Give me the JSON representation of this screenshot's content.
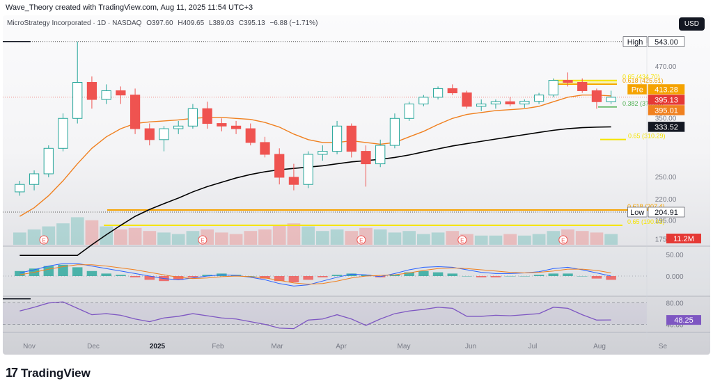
{
  "credit": "Wave_Theory created with TradingView.com, Aug 11, 2025 11:54 UTC+3",
  "symbol": {
    "name": "MicroStrategy Incorporated · 1D · NASDAQ",
    "open": "O397.60",
    "high": "H409.65",
    "low": "L389.03",
    "close": "C395.13",
    "change": "−6.88 (−1.71%)"
  },
  "currency_button": "USD",
  "brand": "TradingView",
  "colors": {
    "up": "#26a69a",
    "down": "#ef5350",
    "ema50": "#f0801f",
    "ema200": "#000000",
    "fib_orange": "#f5a300",
    "fib_yellow": "#f5e400",
    "macd": "#2962ff",
    "rsi": "#7e57c2"
  },
  "chart_data": {
    "type": "candlestick",
    "x_labels": [
      "Nov",
      "Dec",
      "2025",
      "Feb",
      "Mar",
      "Apr",
      "May",
      "Jun",
      "Jul",
      "Aug",
      "Se"
    ],
    "price_axis": {
      "ticks": [
        470.0,
        350.0,
        250.0,
        220.0,
        195.0,
        175.0
      ],
      "tick_labels": [
        "470.00",
        "350.00",
        "250.00",
        "220.00",
        "195.00",
        "175.00"
      ],
      "scale": "log"
    },
    "price_tags": [
      {
        "label": "High",
        "value": "543.00"
      },
      {
        "label": "Pre",
        "value": "413.28"
      },
      {
        "label": "",
        "value": "395.13"
      },
      {
        "label": "",
        "value": "395.01"
      },
      {
        "label": "",
        "value": "333.52"
      },
      {
        "label": "Low",
        "value": "204.91"
      }
    ],
    "fib_levels": [
      {
        "label": "0.65 (434.70)",
        "value": 434.7
      },
      {
        "label": "0.618 (425.61)",
        "value": 425.61
      },
      {
        "label": "0.382 (373.55)",
        "value": 373.55
      },
      {
        "label": "0.65 (310.29)",
        "value": 310.29
      },
      {
        "label": "0.618 (207.4)",
        "value": 207.4
      },
      {
        "label": "0.65 (190.03)",
        "value": 190.03
      }
    ],
    "candles_weekly_approx": [
      {
        "d": "Oct 21",
        "o": 230,
        "h": 245,
        "l": 225,
        "c": 240
      },
      {
        "d": "Oct 28",
        "o": 240,
        "h": 260,
        "l": 232,
        "c": 255
      },
      {
        "d": "Nov 4",
        "o": 255,
        "h": 300,
        "l": 250,
        "c": 295
      },
      {
        "d": "Nov 11",
        "o": 295,
        "h": 360,
        "l": 290,
        "c": 350
      },
      {
        "d": "Nov 18",
        "o": 350,
        "h": 543,
        "l": 340,
        "c": 430
      },
      {
        "d": "Nov 25",
        "o": 430,
        "h": 445,
        "l": 370,
        "c": 390
      },
      {
        "d": "Dec 2",
        "o": 390,
        "h": 425,
        "l": 380,
        "c": 410
      },
      {
        "d": "Dec 9",
        "o": 410,
        "h": 420,
        "l": 380,
        "c": 400
      },
      {
        "d": "Dec 16",
        "o": 400,
        "h": 415,
        "l": 320,
        "c": 330
      },
      {
        "d": "Dec 23",
        "o": 330,
        "h": 340,
        "l": 300,
        "c": 310
      },
      {
        "d": "Dec 30",
        "o": 310,
        "h": 335,
        "l": 290,
        "c": 330
      },
      {
        "d": "Jan 6",
        "o": 330,
        "h": 345,
        "l": 320,
        "c": 335
      },
      {
        "d": "Jan 13",
        "o": 335,
        "h": 380,
        "l": 330,
        "c": 370
      },
      {
        "d": "Jan 20",
        "o": 370,
        "h": 385,
        "l": 330,
        "c": 340
      },
      {
        "d": "Jan 27",
        "o": 340,
        "h": 350,
        "l": 325,
        "c": 335
      },
      {
        "d": "Feb 3",
        "o": 335,
        "h": 345,
        "l": 320,
        "c": 330
      },
      {
        "d": "Feb 10",
        "o": 330,
        "h": 340,
        "l": 300,
        "c": 305
      },
      {
        "d": "Feb 17",
        "o": 305,
        "h": 315,
        "l": 280,
        "c": 285
      },
      {
        "d": "Feb 24",
        "o": 285,
        "h": 295,
        "l": 240,
        "c": 250
      },
      {
        "d": "Mar 3",
        "o": 250,
        "h": 270,
        "l": 232,
        "c": 240
      },
      {
        "d": "Mar 10",
        "o": 240,
        "h": 290,
        "l": 235,
        "c": 285
      },
      {
        "d": "Mar 17",
        "o": 285,
        "h": 300,
        "l": 275,
        "c": 290
      },
      {
        "d": "Mar 24",
        "o": 290,
        "h": 345,
        "l": 285,
        "c": 335
      },
      {
        "d": "Mar 31",
        "o": 335,
        "h": 340,
        "l": 280,
        "c": 290
      },
      {
        "d": "Apr 7",
        "o": 290,
        "h": 300,
        "l": 237,
        "c": 270
      },
      {
        "d": "Apr 14",
        "o": 270,
        "h": 310,
        "l": 265,
        "c": 300
      },
      {
        "d": "Apr 21",
        "o": 300,
        "h": 360,
        "l": 295,
        "c": 350
      },
      {
        "d": "Apr 28",
        "o": 350,
        "h": 385,
        "l": 345,
        "c": 380
      },
      {
        "d": "May 5",
        "o": 380,
        "h": 400,
        "l": 375,
        "c": 395
      },
      {
        "d": "May 12",
        "o": 395,
        "h": 420,
        "l": 390,
        "c": 415
      },
      {
        "d": "May 19",
        "o": 415,
        "h": 425,
        "l": 400,
        "c": 405
      },
      {
        "d": "May 26",
        "o": 405,
        "h": 410,
        "l": 370,
        "c": 375
      },
      {
        "d": "Jun 2",
        "o": 375,
        "h": 390,
        "l": 365,
        "c": 380
      },
      {
        "d": "Jun 9",
        "o": 380,
        "h": 390,
        "l": 370,
        "c": 385
      },
      {
        "d": "Jun 16",
        "o": 385,
        "h": 395,
        "l": 375,
        "c": 380
      },
      {
        "d": "Jun 23",
        "o": 380,
        "h": 390,
        "l": 372,
        "c": 386
      },
      {
        "d": "Jun 30",
        "o": 386,
        "h": 405,
        "l": 380,
        "c": 400
      },
      {
        "d": "Jul 7",
        "o": 400,
        "h": 440,
        "l": 395,
        "c": 435
      },
      {
        "d": "Jul 14",
        "o": 435,
        "h": 455,
        "l": 420,
        "c": 430
      },
      {
        "d": "Jul 21",
        "o": 430,
        "h": 440,
        "l": 405,
        "c": 410
      },
      {
        "d": "Jul 28",
        "o": 410,
        "h": 415,
        "l": 370,
        "c": 385
      },
      {
        "d": "Aug 4",
        "o": 385,
        "h": 410,
        "l": 380,
        "c": 395
      }
    ],
    "ema50_weekly_approx": [
      200,
      210,
      225,
      245,
      270,
      295,
      315,
      330,
      340,
      343,
      345,
      347,
      350,
      352,
      352,
      350,
      348,
      342,
      333,
      320,
      310,
      305,
      305,
      308,
      305,
      302,
      305,
      315,
      325,
      338,
      350,
      358,
      362,
      366,
      368,
      370,
      375,
      385,
      395,
      400,
      400,
      398
    ],
    "ema200_weekly_approx": [
      130,
      135,
      142,
      150,
      160,
      170,
      180,
      190,
      200,
      208,
      215,
      222,
      230,
      237,
      243,
      249,
      254,
      258,
      261,
      263,
      265,
      267,
      270,
      273,
      275,
      277,
      280,
      284,
      289,
      294,
      299,
      303,
      307,
      311,
      315,
      319,
      323,
      327,
      330,
      332,
      333,
      333.52
    ],
    "volume": {
      "label": "11.2M",
      "value_m": 11.2
    },
    "macd": {
      "tick_labels": [
        "50.00",
        "0.000"
      ]
    },
    "rsi": {
      "value": "48.25",
      "tick_labels": [
        "80.00",
        "40.00"
      ],
      "series_approx": [
        65,
        72,
        80,
        82,
        70,
        58,
        60,
        57,
        50,
        45,
        52,
        55,
        60,
        56,
        52,
        50,
        45,
        40,
        33,
        32,
        48,
        50,
        58,
        50,
        38,
        50,
        60,
        65,
        68,
        72,
        70,
        55,
        55,
        57,
        56,
        58,
        60,
        72,
        70,
        58,
        48,
        48.25
      ]
    }
  }
}
